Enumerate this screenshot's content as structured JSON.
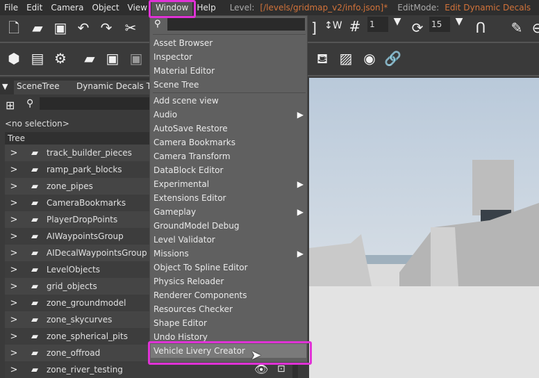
{
  "menubar": {
    "items": [
      "File",
      "Edit",
      "Camera",
      "Object",
      "View",
      "Window",
      "Help"
    ],
    "level_label": "Level:",
    "level_value": "[/levels/gridmap_v2/info.json]*",
    "editmode_label": "EditMode:",
    "editmode_value": "Edit Dynamic Decals"
  },
  "toolbar": {
    "snap_value": "1",
    "rotate_value": "15"
  },
  "tabs": [
    "SceneTree",
    "Dynamic Decals Tool"
  ],
  "scene_tree": {
    "selection": "<no selection>",
    "header": "Tree",
    "items": [
      "track_builder_pieces",
      "ramp_park_blocks",
      "zone_pipes",
      "CameraBookmarks",
      "PlayerDropPoints",
      "AIWaypointsGroup",
      "AIDecalWaypointsGroup",
      "LevelObjects",
      "grid_objects",
      "zone_groundmodel",
      "zone_skycurves",
      "zone_spherical_pits",
      "zone_offroad",
      "zone_river_testing"
    ]
  },
  "window_menu": {
    "search_value": "",
    "group1": [
      "Asset Browser",
      "Inspector",
      "Material Editor",
      "Scene Tree"
    ],
    "group2": [
      {
        "label": "Add scene view"
      },
      {
        "label": "Audio",
        "submenu": true
      },
      {
        "label": "AutoSave Restore"
      },
      {
        "label": "Camera Bookmarks"
      },
      {
        "label": "Camera Transform"
      },
      {
        "label": "DataBlock Editor"
      },
      {
        "label": "Experimental",
        "submenu": true
      },
      {
        "label": "Extensions Editor"
      },
      {
        "label": "Gameplay",
        "submenu": true
      },
      {
        "label": "GroundModel Debug"
      },
      {
        "label": "Level Validator"
      },
      {
        "label": "Missions",
        "submenu": true
      },
      {
        "label": "Object To Spline Editor"
      },
      {
        "label": "Physics Reloader"
      },
      {
        "label": "Renderer Components"
      },
      {
        "label": "Resources Checker"
      },
      {
        "label": "Shape Editor"
      },
      {
        "label": "Undo History"
      },
      {
        "label": "Vehicle Livery Creator",
        "highlighted": true
      }
    ]
  },
  "colors": {
    "highlight": "#e032d6",
    "accent_orange": "#d2733a"
  }
}
